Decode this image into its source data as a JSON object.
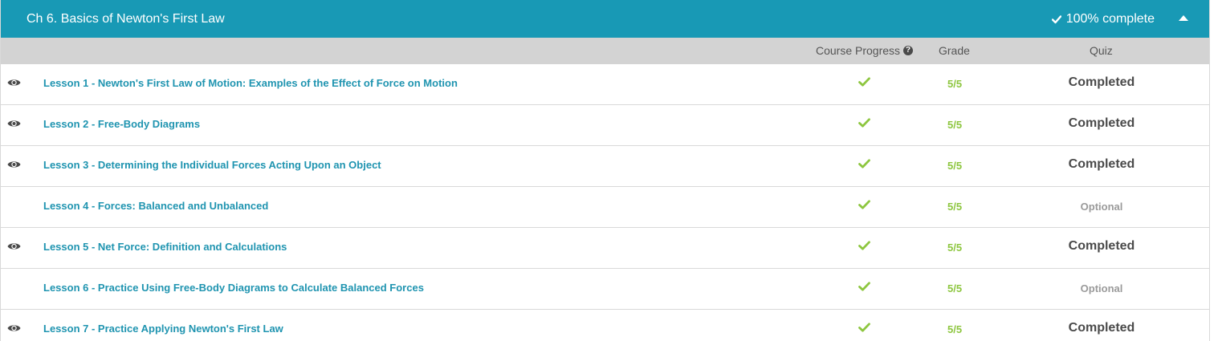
{
  "chapter": {
    "title": "Ch 6. Basics of Newton's First Law",
    "completion": "100% complete",
    "collapse_icon": "chevron-up-icon"
  },
  "columns": {
    "progress": "Course Progress",
    "grade": "Grade",
    "quiz": "Quiz"
  },
  "colors": {
    "header_bg": "#1899b5",
    "link": "#1f94b0",
    "check": "#8dc63f",
    "column_bar": "#d3d3d3"
  },
  "lessons": [
    {
      "title": "Lesson 1 - Newton's First Law of Motion: Examples of the Effect of Force on Motion",
      "viewed": true,
      "progress": "complete",
      "grade": "5/5",
      "quiz": "Completed"
    },
    {
      "title": "Lesson 2 - Free-Body Diagrams",
      "viewed": true,
      "progress": "complete",
      "grade": "5/5",
      "quiz": "Completed"
    },
    {
      "title": "Lesson 3 - Determining the Individual Forces Acting Upon an Object",
      "viewed": true,
      "progress": "complete",
      "grade": "5/5",
      "quiz": "Completed"
    },
    {
      "title": "Lesson 4 - Forces: Balanced and Unbalanced",
      "viewed": false,
      "progress": "complete",
      "grade": "5/5",
      "quiz": "Optional"
    },
    {
      "title": "Lesson 5 - Net Force: Definition and Calculations",
      "viewed": true,
      "progress": "complete",
      "grade": "5/5",
      "quiz": "Completed"
    },
    {
      "title": "Lesson 6 - Practice Using Free-Body Diagrams to Calculate Balanced Forces",
      "viewed": false,
      "progress": "complete",
      "grade": "5/5",
      "quiz": "Optional"
    },
    {
      "title": "Lesson 7 - Practice Applying Newton's First Law",
      "viewed": true,
      "progress": "complete",
      "grade": "5/5",
      "quiz": "Completed"
    }
  ]
}
